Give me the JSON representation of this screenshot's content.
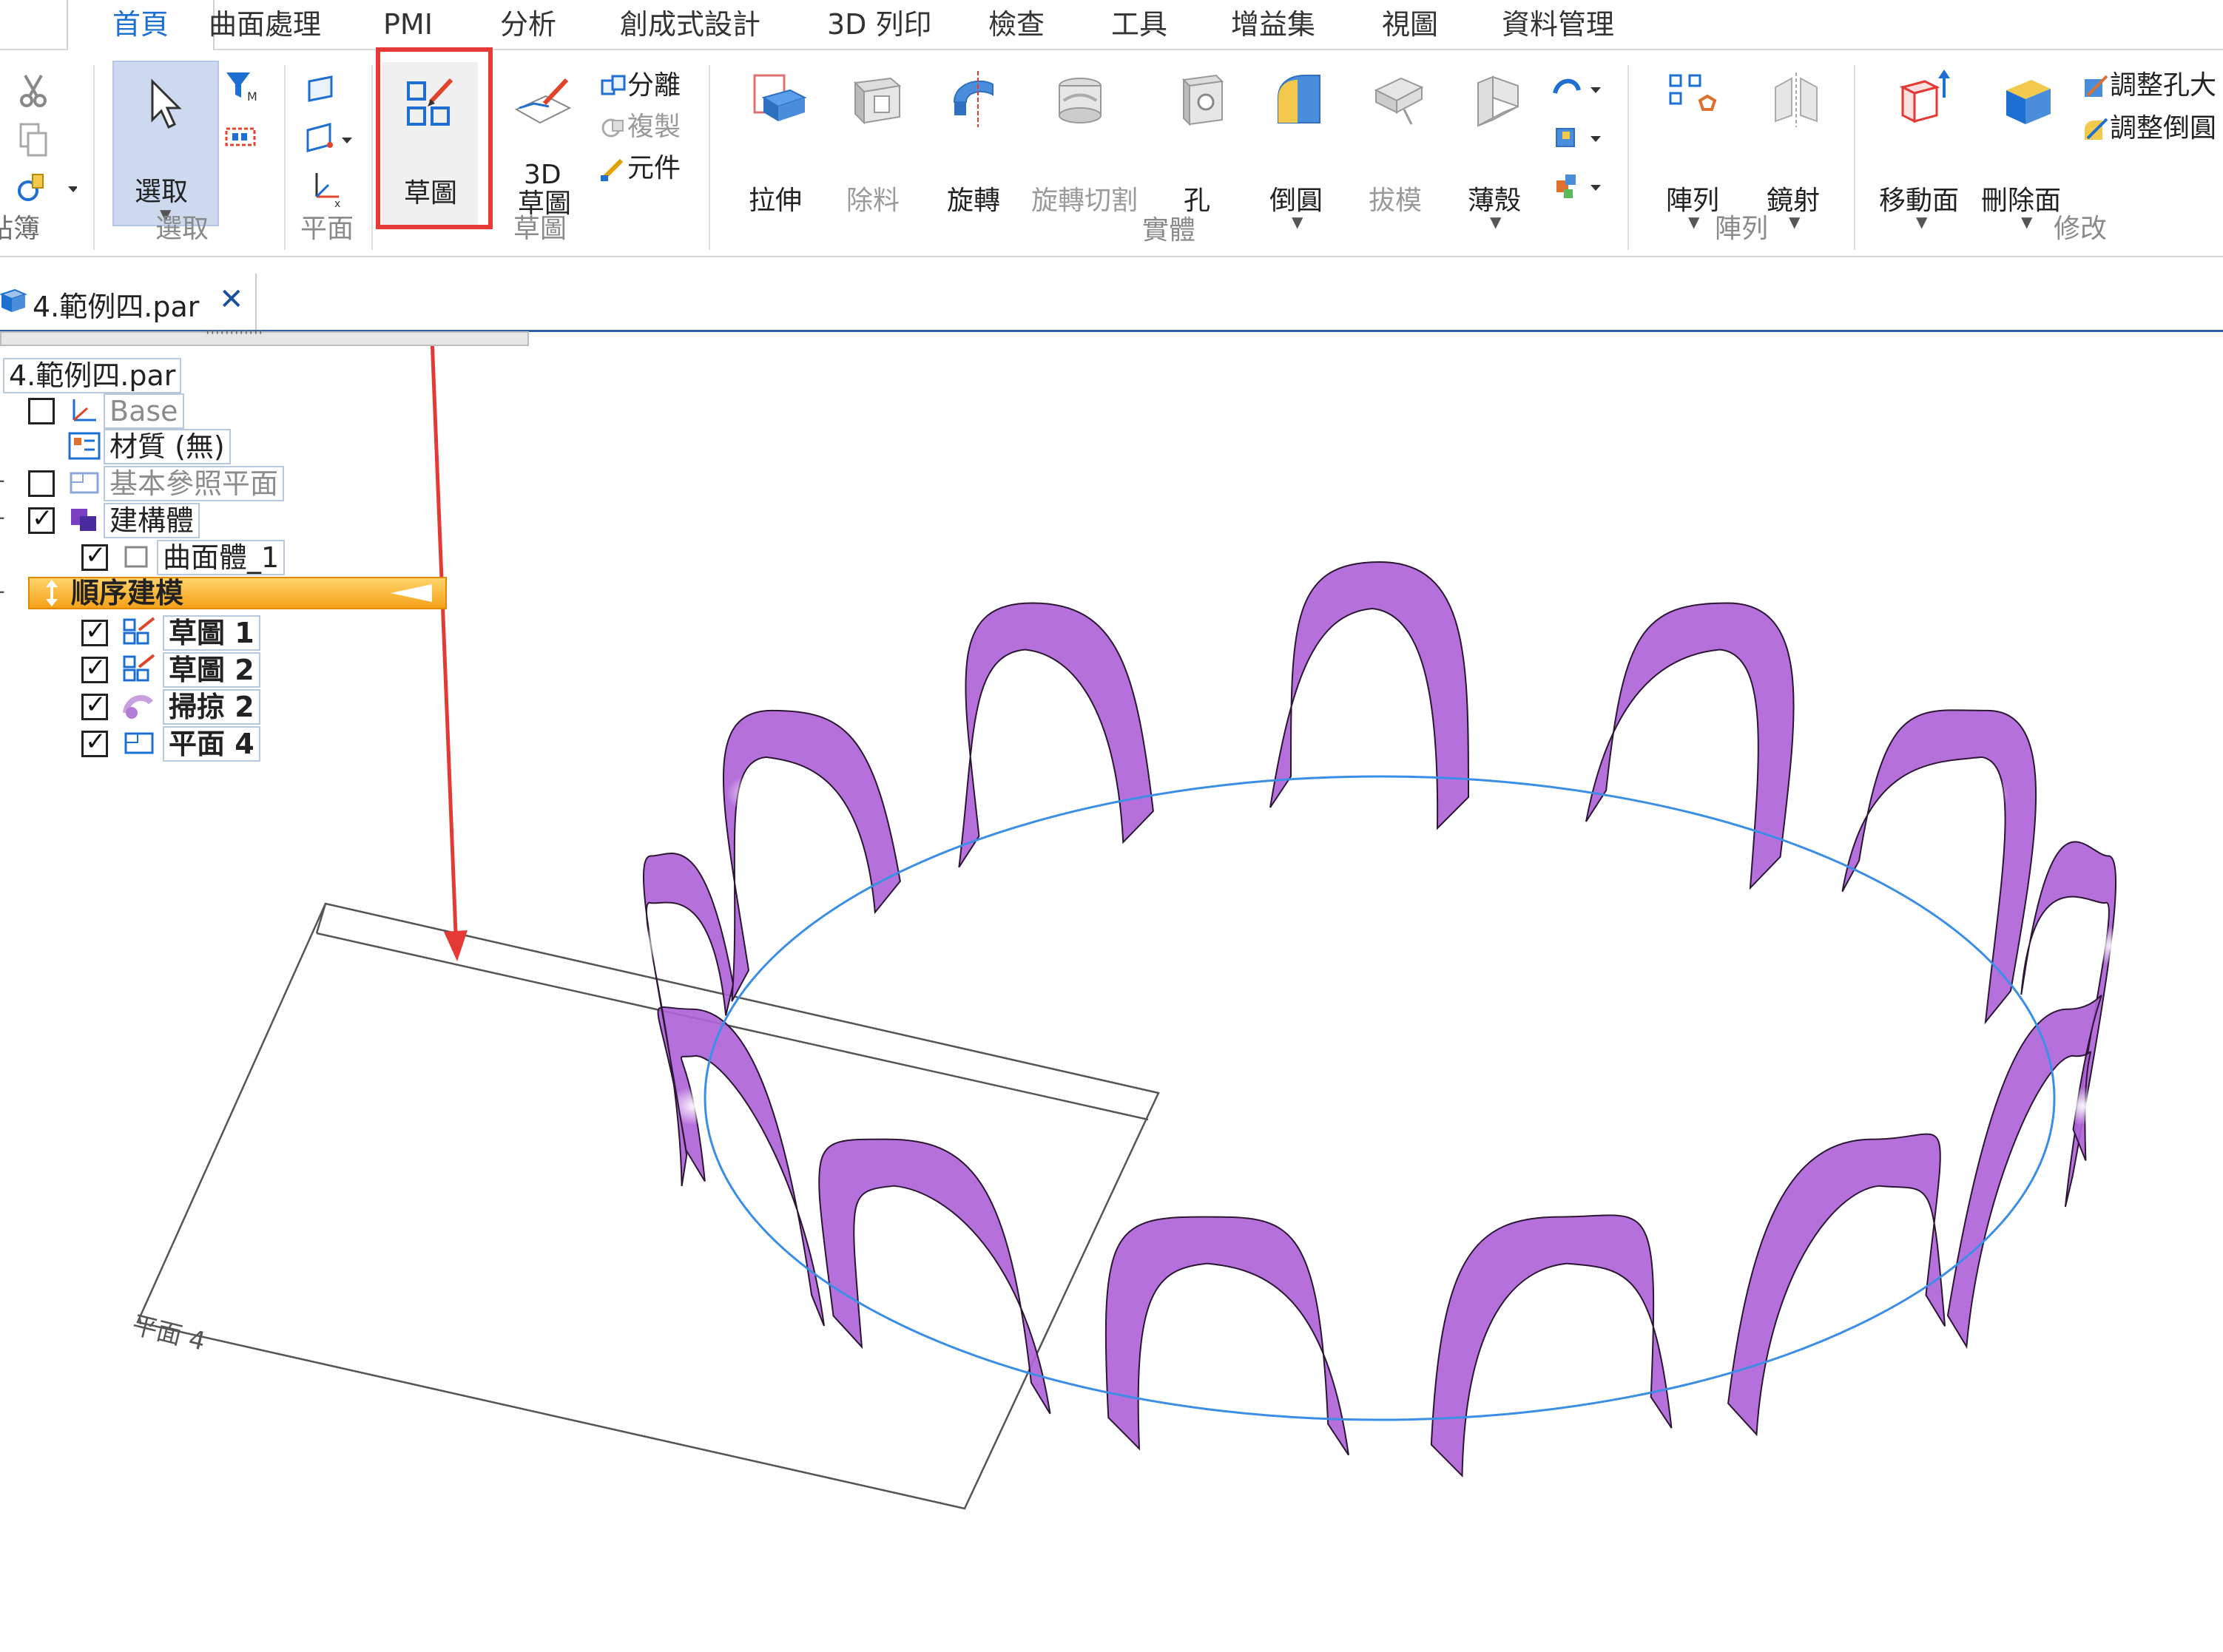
{
  "ribbon": {
    "tabs": [
      "首頁",
      "曲面處理",
      "PMI",
      "分析",
      "創成式設計",
      "3D 列印",
      "檢查",
      "工具",
      "增益集",
      "視圖",
      "資料管理"
    ],
    "active_tab": "首頁",
    "groups": {
      "clipboard": "貼簿",
      "select": "選取",
      "plane": "平面",
      "sketch": "草圖",
      "solid": "實體",
      "pattern": "陣列",
      "modify": "修改"
    },
    "buttons": {
      "select": "選取",
      "sketch": "草圖",
      "sketch3d_top": "3D",
      "sketch3d_bottom": "草圖",
      "split": "分離",
      "copy": "複製",
      "part": "元件",
      "extrude": "拉伸",
      "cutout": "除料",
      "revolve": "旋轉",
      "revolve_cut": "旋轉切割",
      "hole": "孔",
      "round": "倒圓",
      "draft": "拔模",
      "thin_wall": "薄殼",
      "pattern": "陣列",
      "mirror": "鏡射",
      "move_face": "移動面",
      "delete_face": "刪除面",
      "resize_hole": "調整孔大",
      "resize_round": "調整倒圓"
    }
  },
  "document": {
    "tab_title": "4.範例四.par",
    "close": "✕"
  },
  "pathfinder": {
    "root": "4.範例四.par",
    "items": {
      "base": "Base",
      "material": "材質 (無)",
      "ref_planes": "基本參照平面",
      "construction": "建構體",
      "surface_body": "曲面體_1",
      "ordered": "順序建模",
      "sketch1": "草圖 1",
      "sketch2": "草圖 2",
      "sweep2": "掃掠 2",
      "plane4": "平面 4"
    }
  },
  "viewport": {
    "plane_label": "平面 4"
  },
  "colors": {
    "accent": "#1d6fd1",
    "highlight_box": "#e53935",
    "ribbon_surface": "#b064d9",
    "path_curve": "#3a8ee6",
    "ordered_bar": "#f6a21a"
  }
}
